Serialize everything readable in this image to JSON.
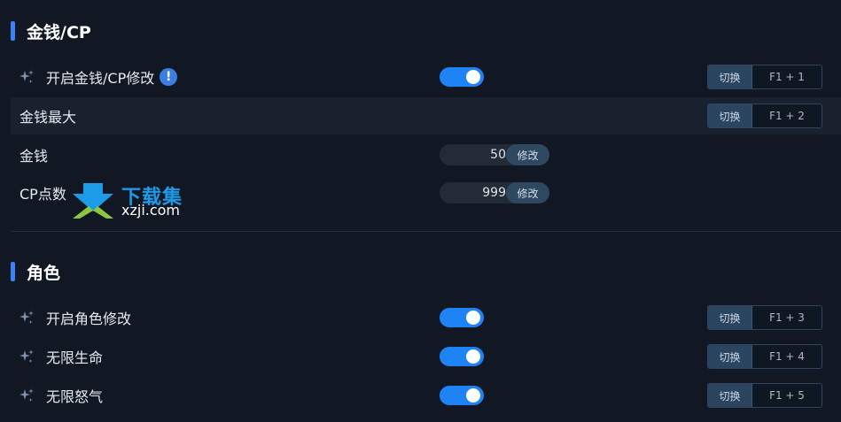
{
  "sections": [
    {
      "title": "金钱/CP",
      "rows": [
        {
          "label": "开启金钱/CP修改",
          "type": "toggle",
          "on": true,
          "hotkey_label": "切换",
          "hotkey": "F1 + 1",
          "info": "!"
        },
        {
          "label": "金钱最大",
          "type": "hotkey",
          "hotkey_label": "切换",
          "hotkey": "F1 + 2"
        },
        {
          "label": "金钱",
          "type": "number",
          "value": "50",
          "button": "修改"
        },
        {
          "label": "CP点数",
          "type": "number",
          "value": "999",
          "button": "修改"
        }
      ]
    },
    {
      "title": "角色",
      "rows": [
        {
          "label": "开启角色修改",
          "type": "toggle",
          "on": true,
          "hotkey_label": "切换",
          "hotkey": "F1 + 3"
        },
        {
          "label": "无限生命",
          "type": "toggle",
          "on": true,
          "hotkey_label": "切换",
          "hotkey": "F1 + 4"
        },
        {
          "label": "无限怒气",
          "type": "toggle",
          "on": true,
          "hotkey_label": "切换",
          "hotkey": "F1 + 5"
        }
      ]
    }
  ],
  "watermark": {
    "text": "下载集",
    "url": "xzji.com"
  },
  "colors": {
    "accent": "#1e84f6",
    "background": "#111823",
    "section_bar": "#3b82f6"
  },
  "icons": {
    "sparkle": "sparkle-icon",
    "info": "info-icon"
  }
}
